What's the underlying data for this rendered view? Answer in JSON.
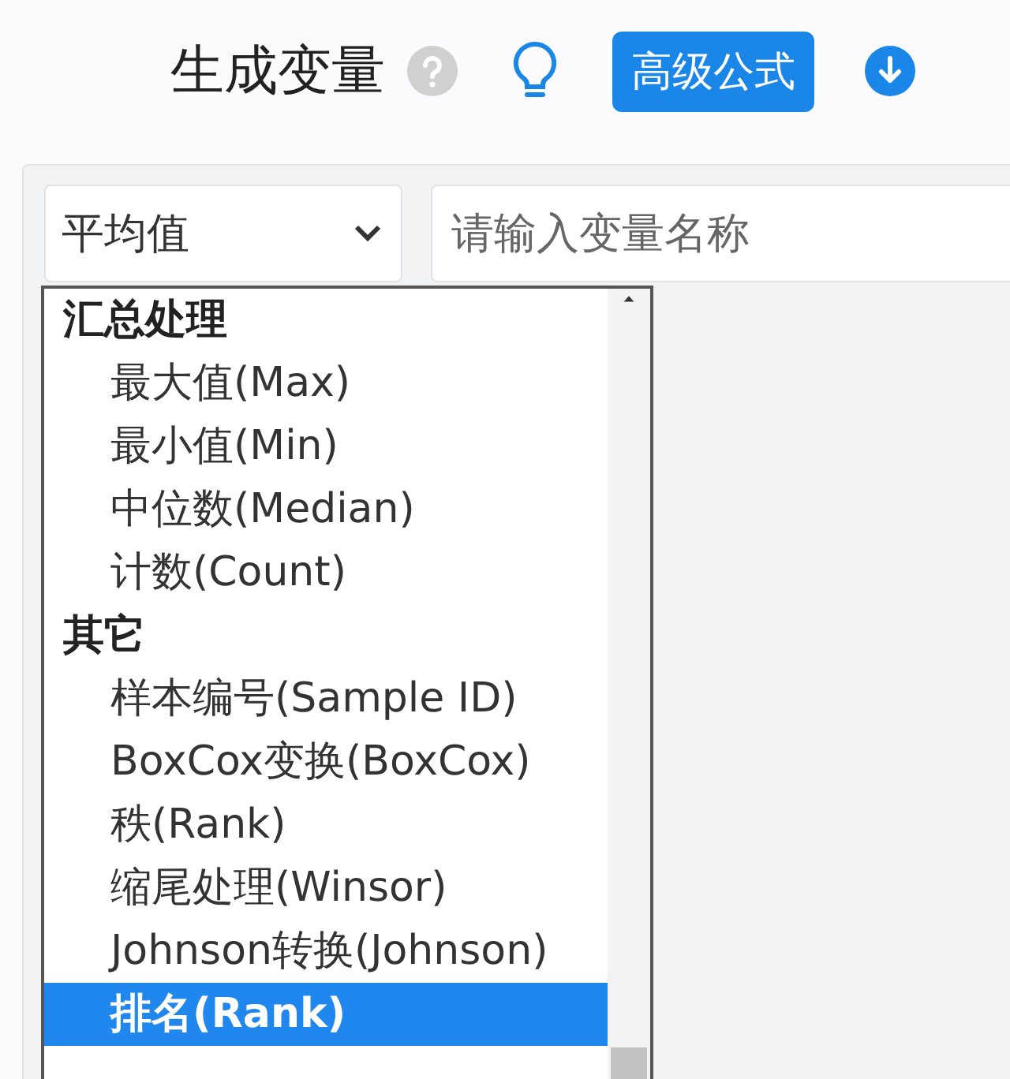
{
  "header": {
    "title": "生成变量",
    "advanced_button": "高级公式"
  },
  "form": {
    "function_select": {
      "value": "平均值",
      "expanded": true
    },
    "name_field": {
      "placeholder": "请输入变量名称"
    }
  },
  "dropdown": {
    "groups": [
      {
        "label": "汇总处理",
        "items": [
          {
            "label": "最大值(Max)",
            "selected": false
          },
          {
            "label": "最小值(Min)",
            "selected": false
          },
          {
            "label": "中位数(Median)",
            "selected": false
          },
          {
            "label": "计数(Count)",
            "selected": false
          }
        ]
      },
      {
        "label": "其它",
        "items": [
          {
            "label": "样本编号(Sample ID)",
            "selected": false
          },
          {
            "label": "BoxCox变换(BoxCox)",
            "selected": false
          },
          {
            "label": "秩(Rank)",
            "selected": false
          },
          {
            "label": "缩尾处理(Winsor)",
            "selected": false
          },
          {
            "label": "Johnson转换(Johnson)",
            "selected": false
          },
          {
            "label": "排名(Rank)",
            "selected": true
          }
        ]
      }
    ]
  }
}
